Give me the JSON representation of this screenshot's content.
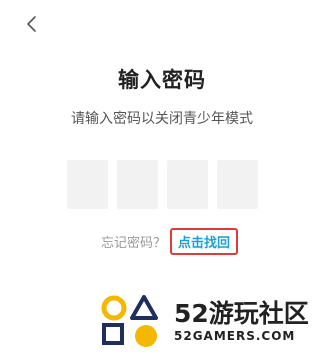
{
  "header": {
    "back_icon": "chevron-left-icon"
  },
  "main": {
    "title": "输入密码",
    "subtitle": "请输入密码以关闭青少年模式",
    "code_box_count": 4
  },
  "forgot": {
    "prompt": "忘记密码？",
    "link_label": "点击找回",
    "link_color": "#1aa0d6",
    "highlight_color": "#e0393e"
  },
  "watermark": {
    "brand": "52游玩社区",
    "url": "52GAMERS.COM"
  }
}
